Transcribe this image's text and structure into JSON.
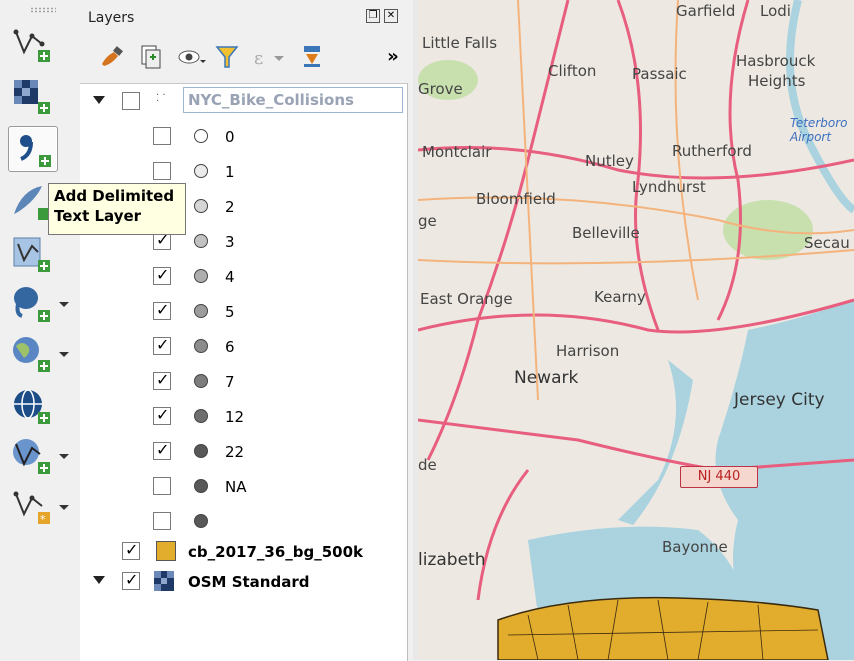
{
  "tooltip": {
    "line1": "Add Delimited",
    "line2": "Text Layer"
  },
  "panel": {
    "title": "Layers"
  },
  "toolbar": {
    "overflow_label": "»"
  },
  "layers": {
    "group_name": "NYC_Bike_Collisions",
    "classes": [
      {
        "label": "0",
        "checked": false,
        "fill": "#ffffff"
      },
      {
        "label": "1",
        "checked": false,
        "fill": "#ebebeb"
      },
      {
        "label": "2",
        "checked": false,
        "fill": "#d6d6d6"
      },
      {
        "label": "3",
        "checked": true,
        "fill": "#c2c2c2"
      },
      {
        "label": "4",
        "checked": true,
        "fill": "#aeaeae"
      },
      {
        "label": "5",
        "checked": true,
        "fill": "#9c9c9c"
      },
      {
        "label": "6",
        "checked": true,
        "fill": "#8c8c8c"
      },
      {
        "label": "7",
        "checked": true,
        "fill": "#7d7d7d"
      },
      {
        "label": "12",
        "checked": true,
        "fill": "#6e6e6e"
      },
      {
        "label": "22",
        "checked": true,
        "fill": "#585858"
      },
      {
        "label": "NA",
        "checked": false,
        "fill": "#585858"
      },
      {
        "label": "",
        "checked": false,
        "fill": "#585858"
      }
    ],
    "polygon_layer": {
      "name": "cb_2017_36_bg_500k",
      "color": "#e2ac2c",
      "checked": true
    },
    "basemap_layer": {
      "name": "OSM Standard",
      "checked": true
    }
  },
  "map": {
    "labels": [
      "Garfield",
      "Lodi",
      "Little Falls",
      "Clifton",
      "Passaic",
      "Hasbrouck",
      "Heights",
      "Grove",
      "Montclair",
      "Nutley",
      "Rutherford",
      "Lyndhurst",
      "Bloomfield",
      "Belleville",
      "ge",
      "Secau",
      "East Orange",
      "Kearny",
      "Harrison",
      "Newark",
      "Jersey City",
      "de",
      "Bayonne",
      "lizabeth"
    ],
    "route_shield": "NJ 440",
    "airport_label": "Teterboro Airport"
  }
}
